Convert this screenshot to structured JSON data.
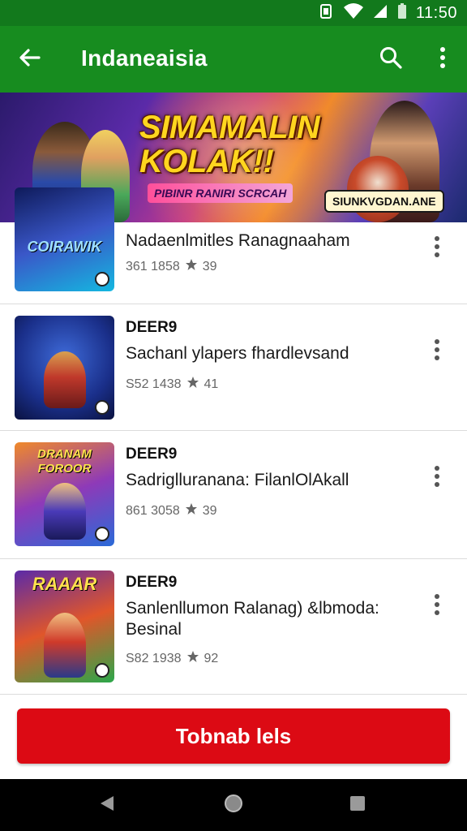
{
  "status_bar": {
    "time": "11:50"
  },
  "app_bar": {
    "title": "Indaneaisia"
  },
  "banner": {
    "headline": "SIMAMALIN KOLAK!!",
    "subtitle": "PIBINR RANIRI SCRCAH",
    "badge": "SIUNKVGDAN.ANE"
  },
  "list": {
    "items": [
      {
        "code": "",
        "title": "Nadaenlmitles Ranagnaaham",
        "meta": "361 1858",
        "rating": "39",
        "thumb_text": "COIRAWIK",
        "thumb_colors": [
          "#0e1a5a",
          "#3a57c8",
          "#14b8e0"
        ]
      },
      {
        "code": "DEER9",
        "title": "Sachanl ylapers fhardlevsand",
        "meta": "S52 1438",
        "rating": "41",
        "thumb_text": "",
        "thumb_colors": [
          "#1a2f8a",
          "#3e6ad8",
          "#c0392b"
        ]
      },
      {
        "code": "DEER9",
        "title": "Sadriglluranana: FilanlOlAkall",
        "meta": "861 3058",
        "rating": "39",
        "thumb_text": "DRANAM FOROOR",
        "thumb_colors": [
          "#f08a2a",
          "#8e3ab8",
          "#2a6ad8"
        ]
      },
      {
        "code": "DEER9",
        "title": "Sanlenllumon Ralanag) &lbmoda: Besinal",
        "meta": "S82 1938",
        "rating": "92",
        "thumb_text": "RAAAR",
        "thumb_colors": [
          "#5b2aa8",
          "#e0562a",
          "#2aa84a"
        ]
      }
    ]
  },
  "action": {
    "button_label": "Tobnab lels"
  },
  "colors": {
    "status_bar": "#12791c",
    "app_bar": "#178c1f",
    "primary_button": "#dc0a14"
  },
  "icons": {
    "back": "arrow-left-icon",
    "search": "search-icon",
    "more": "more-vertical-icon",
    "star": "star-icon"
  }
}
